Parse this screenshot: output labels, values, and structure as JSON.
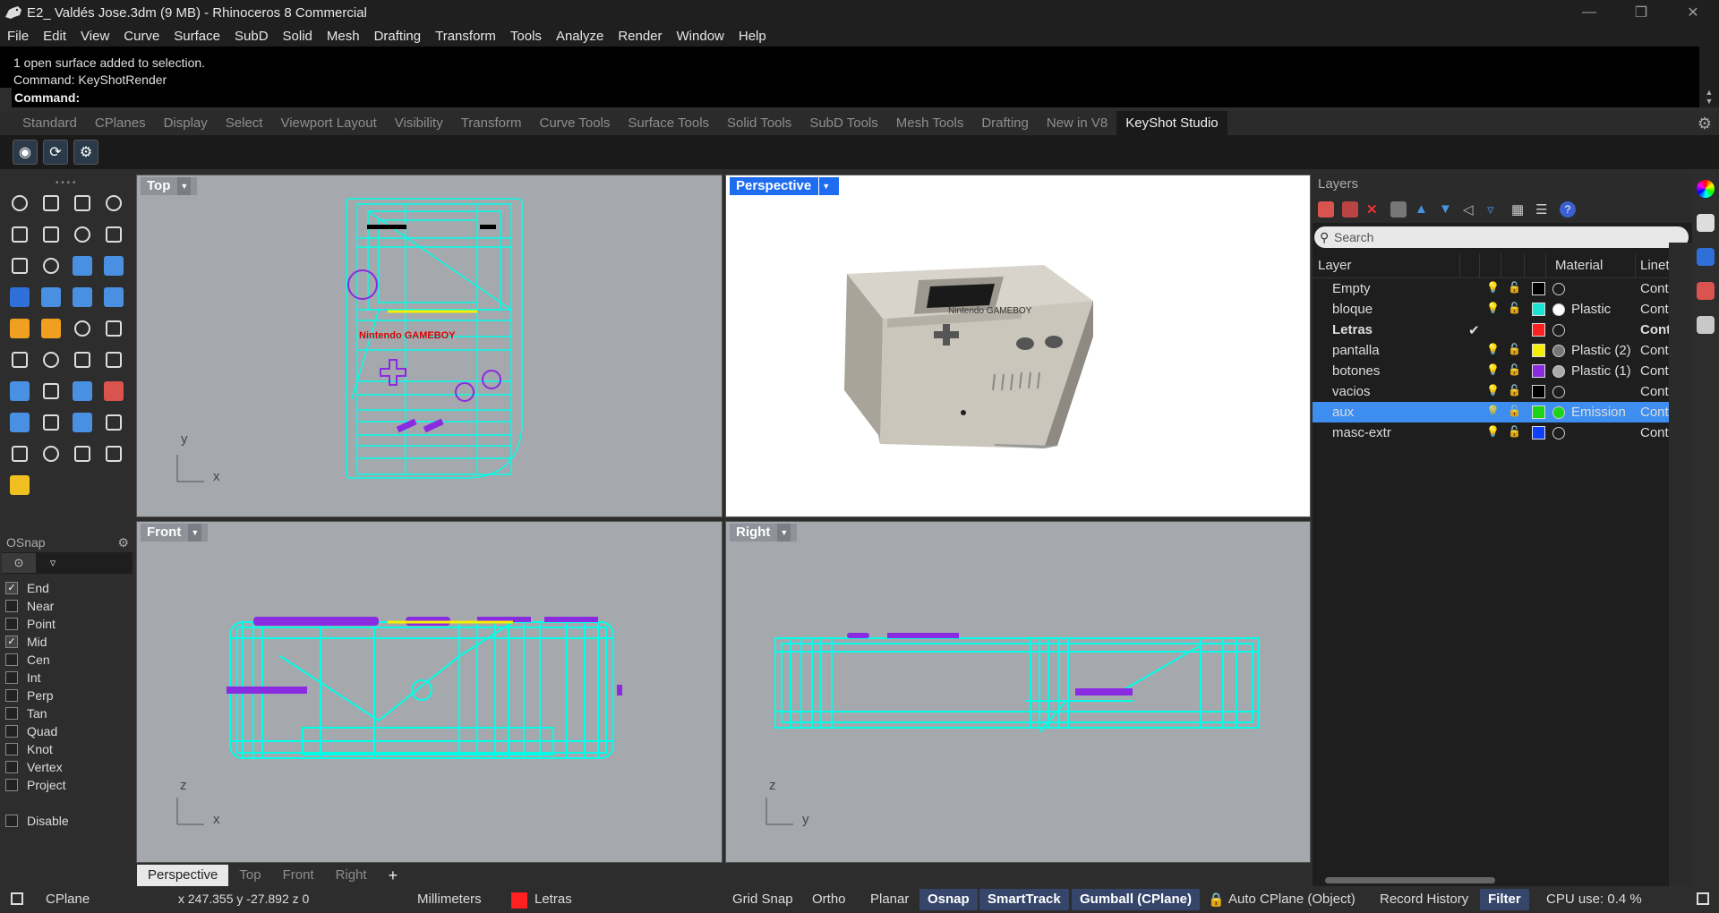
{
  "window": {
    "title": "E2_ Valdés Jose.3dm (9 MB) - Rhinoceros 8 Commercial"
  },
  "menu": [
    "File",
    "Edit",
    "View",
    "Curve",
    "Surface",
    "SubD",
    "Solid",
    "Mesh",
    "Drafting",
    "Transform",
    "Tools",
    "Analyze",
    "Render",
    "Window",
    "Help"
  ],
  "command": {
    "history": [
      "1 open surface added to selection.",
      "Command: KeyShotRender"
    ],
    "prompt": "Command:"
  },
  "tabs": [
    "Standard",
    "CPlanes",
    "Display",
    "Select",
    "Viewport Layout",
    "Visibility",
    "Transform",
    "Curve Tools",
    "Surface Tools",
    "Solid Tools",
    "SubD Tools",
    "Mesh Tools",
    "Drafting",
    "New in V8",
    "KeyShot Studio"
  ],
  "active_tab": "KeyShot Studio",
  "viewports": {
    "top": {
      "label": "Top",
      "axis_y": "y",
      "axis_x": "x"
    },
    "perspective": {
      "label": "Perspective"
    },
    "front": {
      "label": "Front",
      "axis_y": "z",
      "axis_x": "x"
    },
    "right": {
      "label": "Right",
      "axis_y": "z",
      "axis_x": "y"
    }
  },
  "viewport_tabs": [
    "Perspective",
    "Top",
    "Front",
    "Right"
  ],
  "osnap": {
    "title": "OSnap",
    "items": [
      {
        "label": "End",
        "checked": true
      },
      {
        "label": "Near",
        "checked": false
      },
      {
        "label": "Point",
        "checked": false
      },
      {
        "label": "Mid",
        "checked": true
      },
      {
        "label": "Cen",
        "checked": false
      },
      {
        "label": "Int",
        "checked": false
      },
      {
        "label": "Perp",
        "checked": false
      },
      {
        "label": "Tan",
        "checked": false
      },
      {
        "label": "Quad",
        "checked": false
      },
      {
        "label": "Knot",
        "checked": false
      },
      {
        "label": "Vertex",
        "checked": false
      },
      {
        "label": "Project",
        "checked": false
      }
    ],
    "disable": "Disable"
  },
  "layers": {
    "title": "Layers",
    "search_placeholder": "Search",
    "columns": {
      "layer": "Layer",
      "material": "Material",
      "linetype": "Linetype"
    },
    "rows": [
      {
        "name": "Empty",
        "color": "#000000",
        "material": "",
        "mat_color": "transparent",
        "linetype": "Continuous",
        "current": false,
        "selected": false
      },
      {
        "name": "bloque",
        "color": "#19e3d4",
        "material": "Plastic",
        "mat_color": "#ffffff",
        "linetype": "Continuous",
        "current": false,
        "selected": false
      },
      {
        "name": "Letras",
        "color": "#ff2020",
        "material": "",
        "mat_color": "transparent",
        "linetype": "Continuous",
        "current": true,
        "selected": false
      },
      {
        "name": "pantalla",
        "color": "#f5f000",
        "material": "Plastic (2)",
        "mat_color": "#777777",
        "linetype": "Continuous",
        "current": false,
        "selected": false
      },
      {
        "name": "botones",
        "color": "#8a2be2",
        "material": "Plastic (1)",
        "mat_color": "#aaaaaa",
        "linetype": "Continuous",
        "current": false,
        "selected": false
      },
      {
        "name": "vacios",
        "color": "#000000",
        "material": "",
        "mat_color": "transparent",
        "linetype": "Continuous",
        "current": false,
        "selected": false
      },
      {
        "name": "aux",
        "color": "#19d419",
        "material": "Emission",
        "mat_color": "#19d419",
        "linetype": "Continuous",
        "current": false,
        "selected": true
      },
      {
        "name": "masc-extr",
        "color": "#1040ff",
        "material": "",
        "mat_color": "transparent",
        "linetype": "Continuous",
        "current": false,
        "selected": false
      }
    ]
  },
  "status": {
    "cplane": "CPlane",
    "coords": "x 247.355  y -27.892  z 0",
    "units": "Millimeters",
    "layer": "Letras",
    "layer_color": "#ff2020",
    "grid_snap": "Grid Snap",
    "ortho": "Ortho",
    "planar": "Planar",
    "osnap": "Osnap",
    "smarttrack": "SmartTrack",
    "gumball": "Gumball (CPlane)",
    "auto_cplane": "Auto CPlane (Object)",
    "record_history": "Record History",
    "filter": "Filter",
    "cpu": "CPU use: 0.4 %"
  },
  "model_text": {
    "brand": "Nintendo GAMEBOY"
  }
}
